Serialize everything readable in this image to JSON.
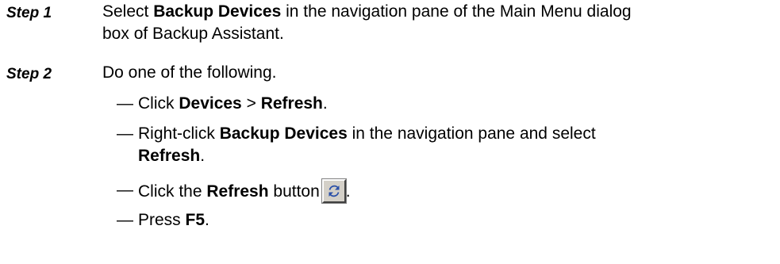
{
  "steps": [
    {
      "label": "Step 1",
      "text_pre": "Select ",
      "bold_1": "Backup Devices",
      "text_post": " in the navigation pane of the Main Menu dialog",
      "line2": "box of Backup Assistant."
    },
    {
      "label": "Step 2",
      "text": "Do one of the following."
    }
  ],
  "bullets": {
    "dash": "—",
    "b1": {
      "pre": "Click ",
      "bold_a": "Devices",
      "mid": " > ",
      "bold_b": "Refresh",
      "post": "."
    },
    "b2": {
      "pre": "Right-click ",
      "bold_a": "Backup Devices",
      "post": " in the navigation pane and select",
      "bold_b": "Refresh",
      "post2": "."
    },
    "b3": {
      "pre": "Click the ",
      "bold_a": "Refresh",
      "post": " button",
      "post2": "."
    },
    "b4": {
      "pre": "Press ",
      "bold_a": "F5",
      "post": "."
    }
  },
  "icons": {
    "refresh_button": "refresh-icon",
    "accent": "#2a4fa8"
  }
}
